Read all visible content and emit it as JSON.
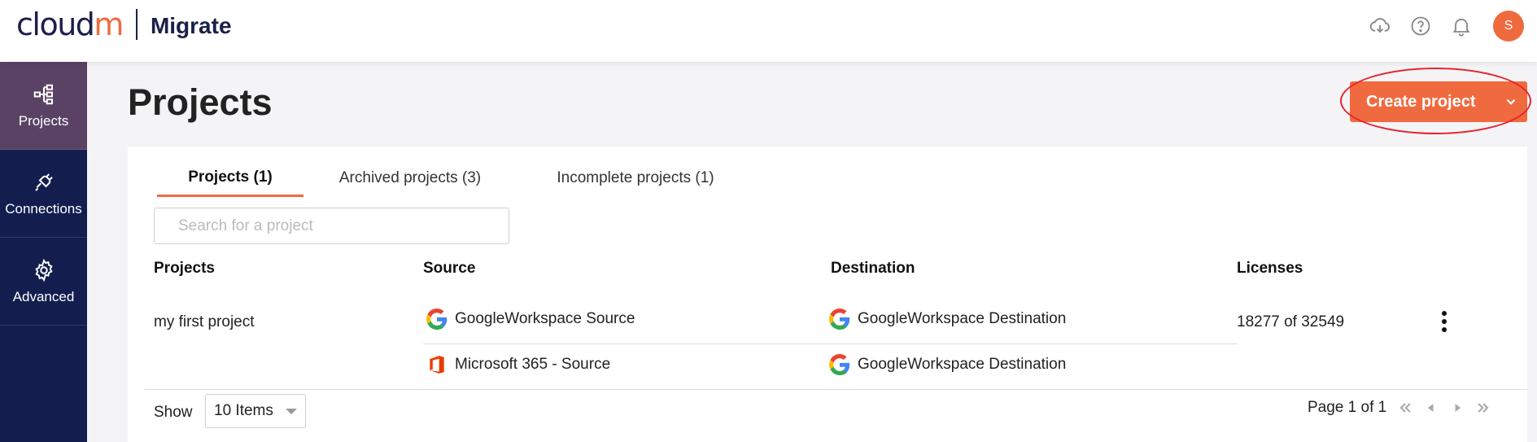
{
  "header": {
    "logo_main": "cloud",
    "logo_accent": "m",
    "product": "Migrate",
    "icons": [
      "cloud-download-icon",
      "help-icon",
      "bell-icon"
    ],
    "avatar_initial": "S"
  },
  "sidebar": {
    "items": [
      {
        "label": "Projects",
        "icon": "hierarchy-icon",
        "active": true
      },
      {
        "label": "Connections",
        "icon": "plug-icon",
        "active": false
      },
      {
        "label": "Advanced",
        "icon": "gear-icon",
        "active": false
      }
    ]
  },
  "page": {
    "title": "Projects",
    "create_button": "Create project"
  },
  "tabs": [
    {
      "label": "Projects (1)",
      "active": true
    },
    {
      "label": "Archived projects (3)",
      "active": false
    },
    {
      "label": "Incomplete projects (1)",
      "active": false
    }
  ],
  "search": {
    "placeholder": "Search for a project",
    "value": ""
  },
  "table": {
    "headers": [
      "Projects",
      "Source",
      "Destination",
      "Licenses"
    ],
    "rows": [
      {
        "project": "my first project",
        "connections": [
          {
            "source": "GoogleWorkspace Source",
            "source_icon": "google-icon",
            "destination": "GoogleWorkspace Destination",
            "destination_icon": "google-icon"
          },
          {
            "source": "Microsoft 365 - Source",
            "source_icon": "office-icon",
            "destination": "GoogleWorkspace Destination",
            "destination_icon": "google-icon"
          }
        ],
        "licenses": "18277 of 32549"
      }
    ]
  },
  "pagination": {
    "show_label": "Show",
    "page_size": "10 Items",
    "page_text": "Page 1 of 1"
  },
  "colors": {
    "accent": "#f06a3f",
    "sidebar": "#131e4f",
    "sidebar_active": "#5a4265",
    "annotation_ring": "#e8222d"
  }
}
